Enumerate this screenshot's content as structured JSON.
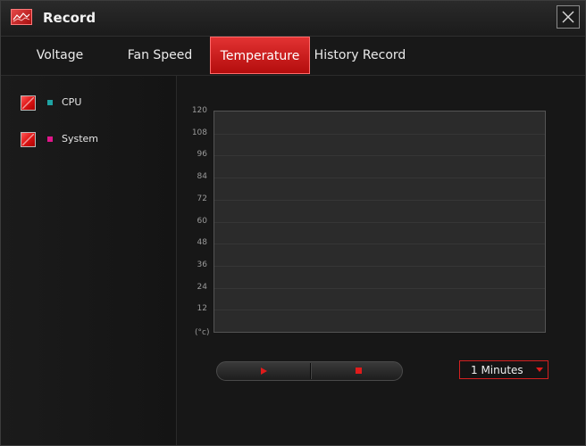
{
  "window": {
    "title": "Record",
    "app_icon": "chart-record-icon",
    "close_icon": "close-icon"
  },
  "tabs": [
    {
      "label": "Voltage",
      "active": false
    },
    {
      "label": "Fan Speed",
      "active": false
    },
    {
      "label": "Temperature",
      "active": true
    },
    {
      "label": "History Record",
      "active": false
    }
  ],
  "legend": [
    {
      "label": "CPU",
      "color": "#1fa3a3",
      "checked": true
    },
    {
      "label": "System",
      "color": "#e0168a",
      "checked": true
    }
  ],
  "chart_data": {
    "type": "line",
    "ylabel": "(°c)",
    "ylim": [
      0,
      120
    ],
    "yticks": [
      "120",
      "108",
      "96",
      "84",
      "72",
      "60",
      "48",
      "36",
      "24",
      "12"
    ],
    "grid": true,
    "series": []
  },
  "controls": {
    "play_icon": "play-icon",
    "stop_icon": "stop-icon"
  },
  "interval_select": {
    "value": "1 Minutes"
  },
  "colors": {
    "accent": "#e01b1b",
    "background": "#161616"
  }
}
